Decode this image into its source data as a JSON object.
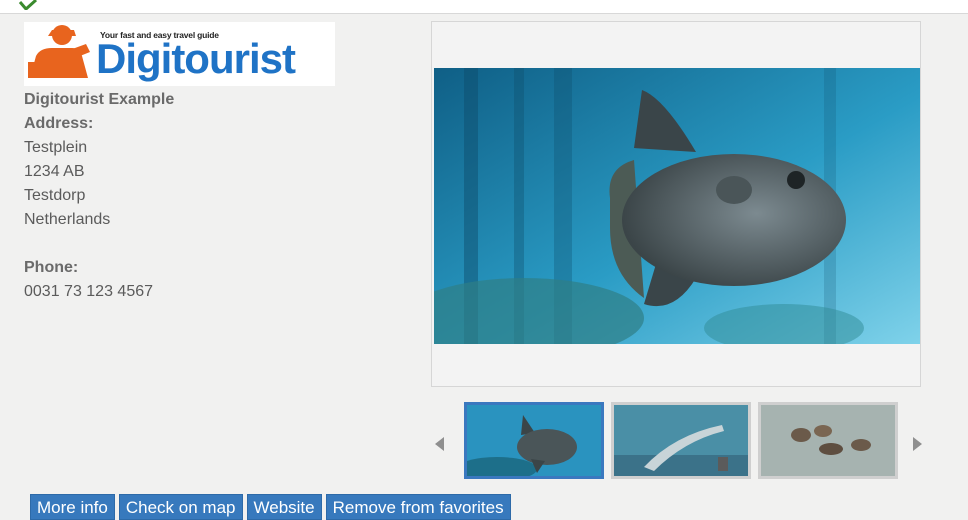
{
  "logo": {
    "tagline": "Your fast and easy travel guide",
    "brand": "Digitourist"
  },
  "info": {
    "name": "Digitourist Example",
    "address_label": "Address:",
    "street": "Testplein",
    "postcode": "1234 AB",
    "city": "Testdorp",
    "country": "Netherlands",
    "phone_label": "Phone:",
    "phone": "0031 73 123 4567"
  },
  "gallery": {
    "active_index": 0
  },
  "actions": {
    "more_info": "More info",
    "check_on_map": "Check on map",
    "website": "Website",
    "remove_favorites": "Remove from favorites"
  },
  "colors": {
    "accent": "#3779bd",
    "brand": "#1f73c6",
    "logo_orange": "#e8641e"
  }
}
